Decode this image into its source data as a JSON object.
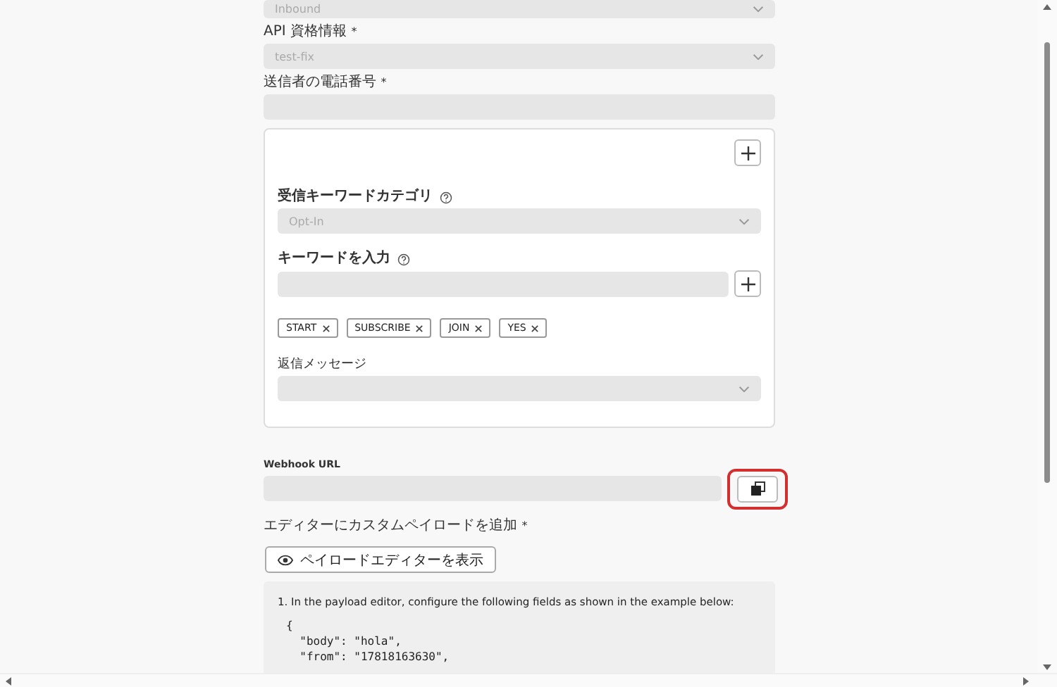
{
  "inbound_select": {
    "value": "Inbound"
  },
  "api_credentials": {
    "label": "API 資格情報",
    "required_mark": "*",
    "value": "test-fix"
  },
  "sender_phone": {
    "label": "送信者の電話番号",
    "required_mark": "*"
  },
  "keyword_card": {
    "category": {
      "label": "受信キーワードカテゴリ",
      "value": "Opt-In"
    },
    "keyword_input": {
      "label": "キーワードを入力"
    },
    "tags": [
      "START",
      "SUBSCRIBE",
      "JOIN",
      "YES"
    ],
    "reply": {
      "label": "返信メッセージ"
    }
  },
  "webhook": {
    "label": "Webhook URL",
    "copy_highlighted": true
  },
  "custom_payload": {
    "label": "エディターにカスタムペイロードを追加",
    "required_mark": "*",
    "button": "ペイロードエディターを表示"
  },
  "instructions": {
    "text": "1. In the payload editor, configure the following fields as shown in the example below:",
    "code": [
      "{",
      "  \"body\": \"hola\",",
      "  \"from\": \"17818163630\","
    ]
  }
}
